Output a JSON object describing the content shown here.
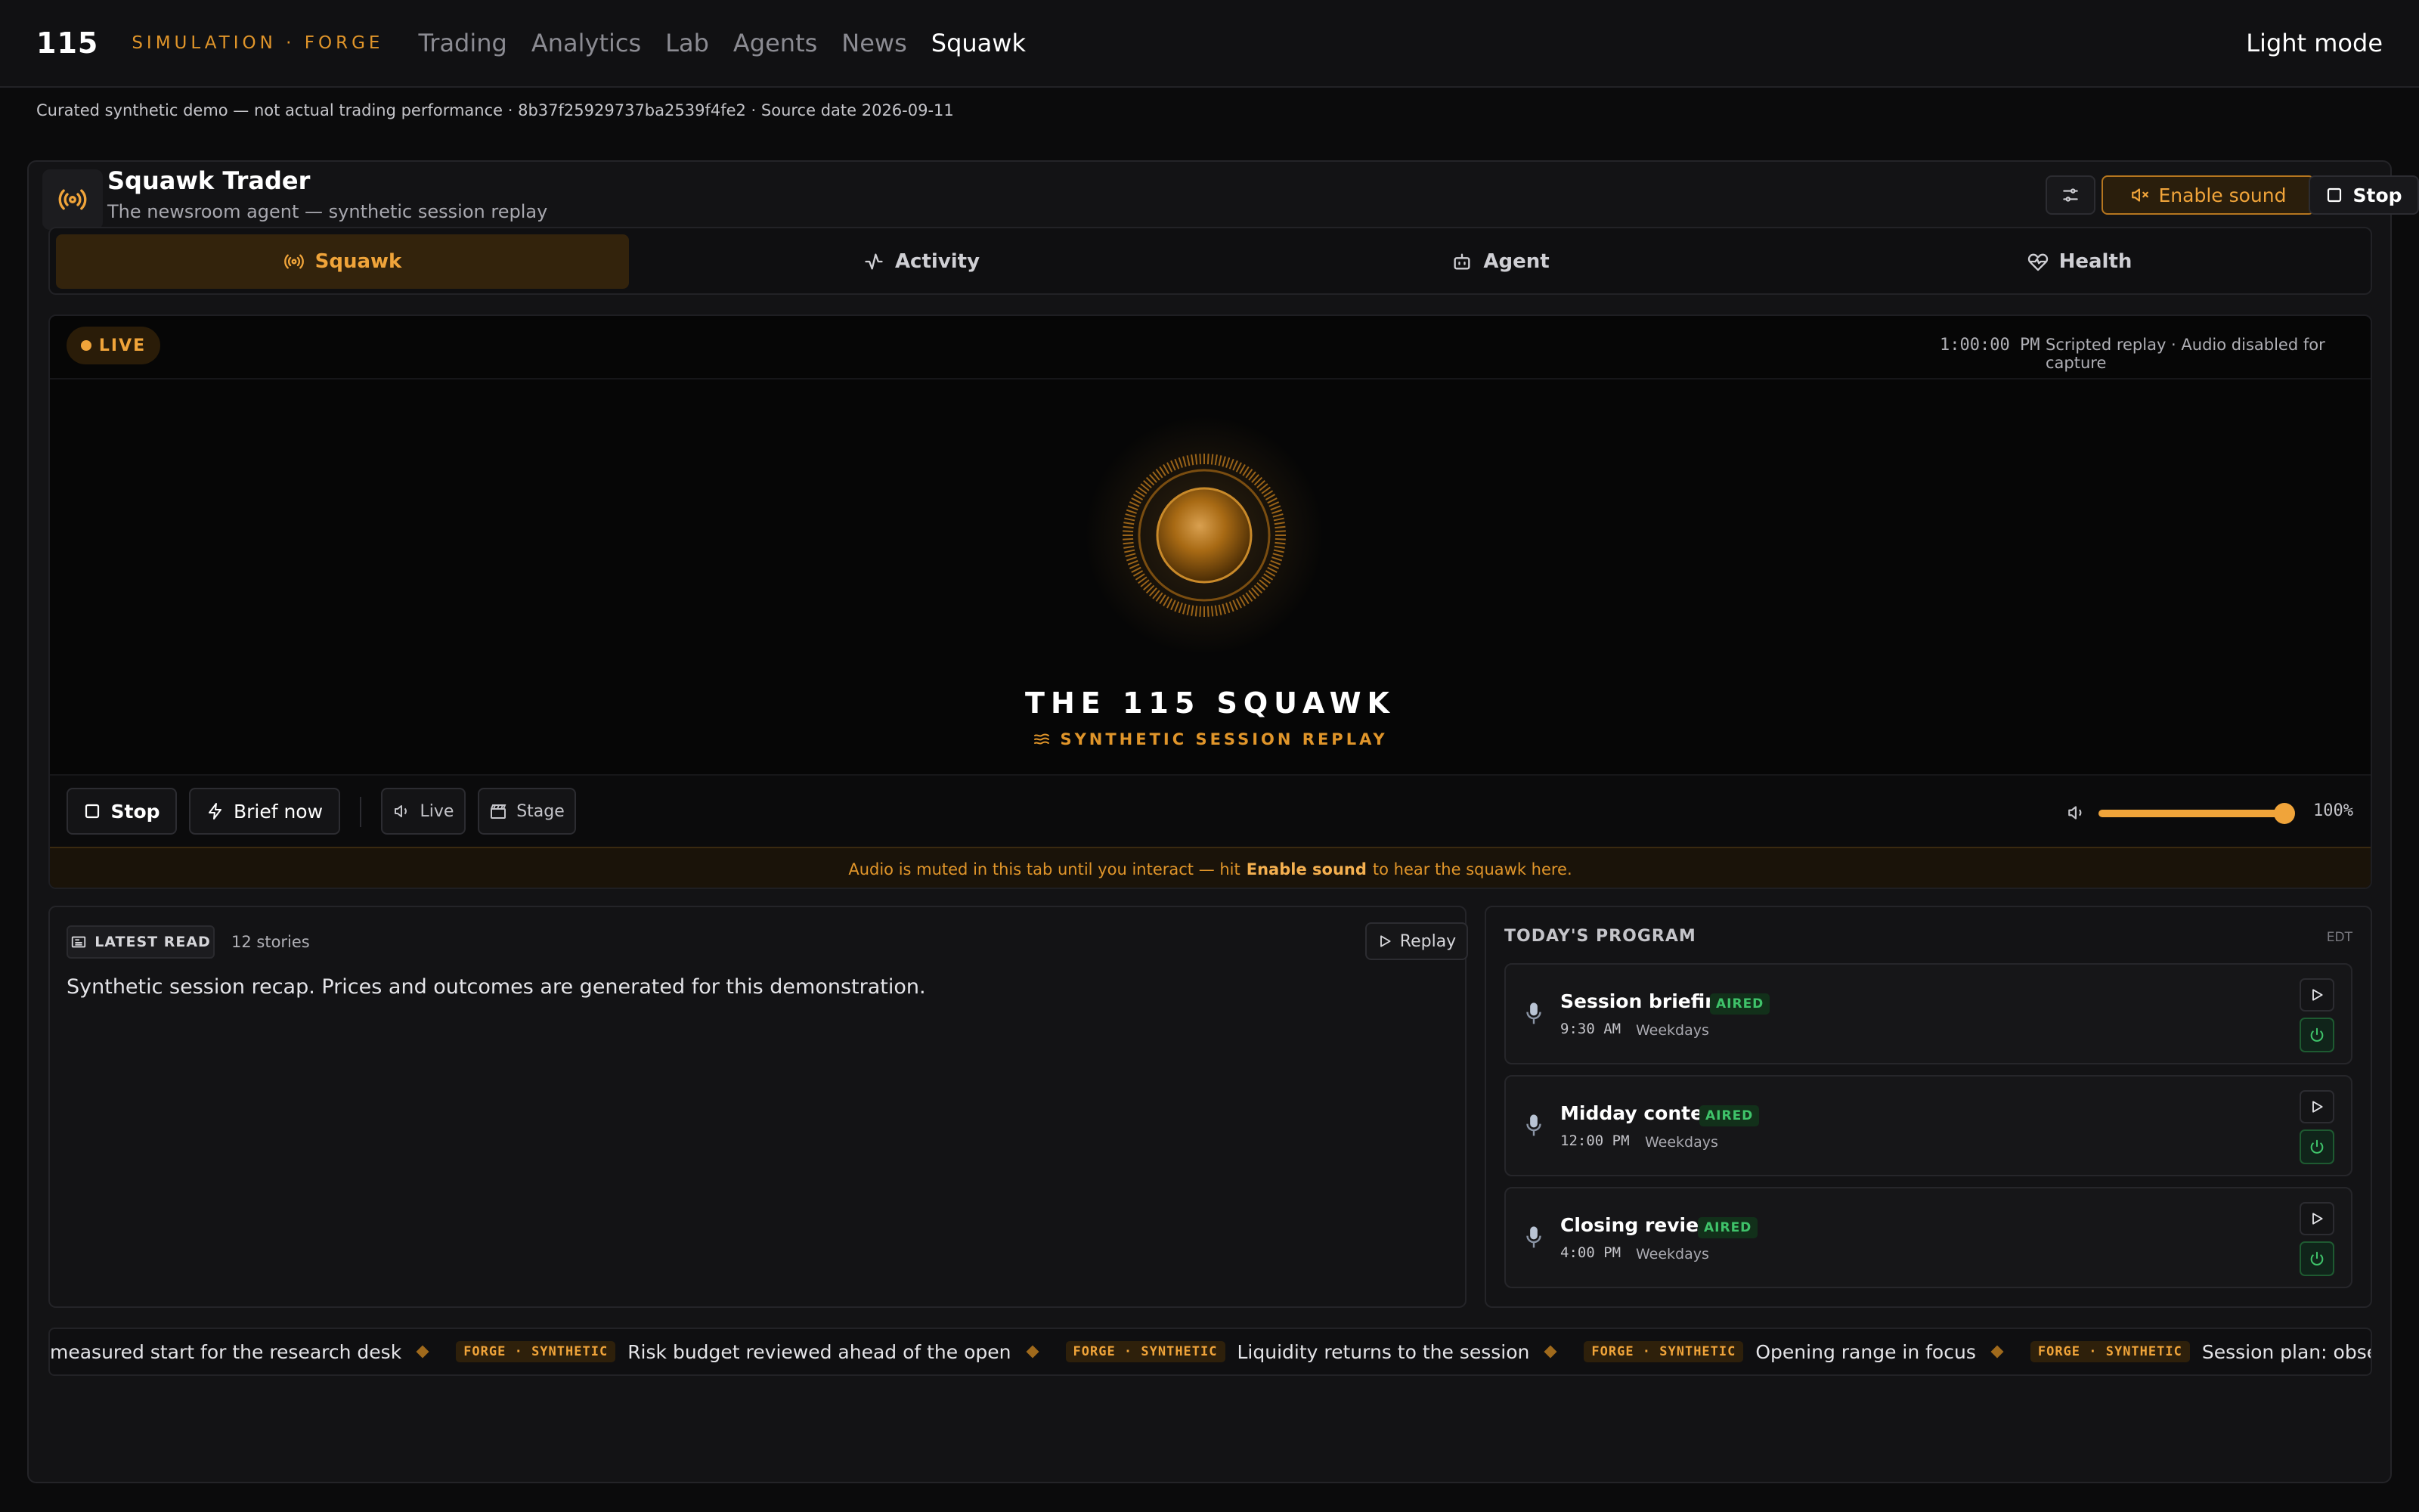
{
  "nav": {
    "logo": "115",
    "sim_label": "SIMULATION · FORGE",
    "links": [
      "Trading",
      "Analytics",
      "Lab",
      "Agents",
      "News",
      "Squawk"
    ],
    "active": "Squawk",
    "light_mode": "Light mode"
  },
  "disclaimer": "Curated synthetic demo — not actual trading performance · 8b37f25929737ba2539f4fe2 · Source date 2026-09-11",
  "header": {
    "title": "Squawk Trader",
    "subtitle": "The newsroom agent — synthetic session replay",
    "enable_sound": "Enable sound",
    "stop": "Stop"
  },
  "tabs": [
    {
      "label": "Squawk",
      "icon": "broadcast-icon",
      "active": true
    },
    {
      "label": "Activity",
      "icon": "activity-icon",
      "active": false
    },
    {
      "label": "Agent",
      "icon": "robot-icon",
      "active": false
    },
    {
      "label": "Health",
      "icon": "heart-pulse-icon",
      "active": false
    }
  ],
  "stage": {
    "live": "LIVE",
    "time": "1:00:00 PM",
    "note": "Scripted replay · Audio disabled for capture",
    "title": "THE 115 SQUAWK",
    "subtitle": "SYNTHETIC SESSION REPLAY"
  },
  "controls": {
    "stop": "Stop",
    "brief_now": "Brief now",
    "live": "Live",
    "stage": "Stage",
    "volume": "100%",
    "volume_fraction": 1.0
  },
  "mute_bar": {
    "before": "Audio is muted in this tab until you interact — hit",
    "action": "Enable sound",
    "after": "to hear the squawk here."
  },
  "latest": {
    "badge": "LATEST READ",
    "count": "12 stories",
    "replay": "Replay",
    "text": "Synthetic session recap. Prices and outcomes are generated for this demonstration."
  },
  "program": {
    "title": "TODAY'S PROGRAM",
    "tz": "EDT",
    "items": [
      {
        "name": "Session briefing",
        "status": "AIRED",
        "time": "9:30 AM",
        "days": "Weekdays"
      },
      {
        "name": "Midday context",
        "status": "AIRED",
        "time": "12:00 PM",
        "days": "Weekdays"
      },
      {
        "name": "Closing review",
        "status": "AIRED",
        "time": "4:00 PM",
        "days": "Weekdays"
      }
    ]
  },
  "ticker": {
    "tag": "FORGE · SYNTHETIC",
    "items": [
      "measured start for the research desk",
      "Risk budget reviewed ahead of the open",
      "Liquidity returns to the session",
      "Opening range in focus",
      "Session plan: observe, execute"
    ]
  },
  "colors": {
    "accent": "#f0a43a",
    "aired": "#3fc36a",
    "background": "#0b0b0c"
  }
}
